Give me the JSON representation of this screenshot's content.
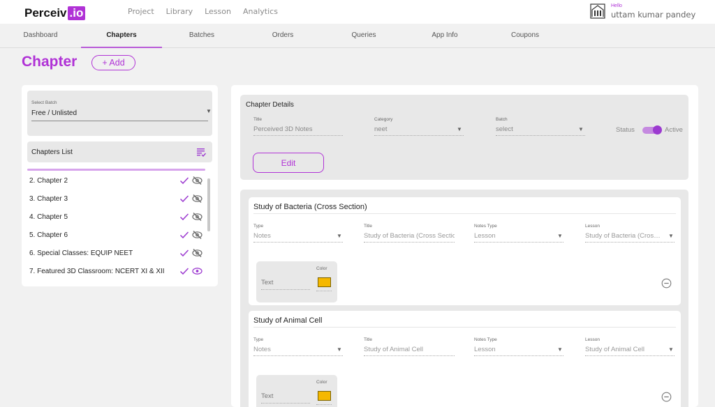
{
  "app": {
    "logo_main": "Perceiv",
    "logo_accent": ".io",
    "brand_color": "#b032d6"
  },
  "topnav": [
    "Project",
    "Library",
    "Lesson",
    "Analytics"
  ],
  "user": {
    "greeting": "Hello",
    "name": "uttam kumar pandey",
    "avatar_icon": "avatar-icon"
  },
  "tabs": [
    {
      "label": "Dashboard",
      "active": false
    },
    {
      "label": "Chapters",
      "active": true
    },
    {
      "label": "Batches",
      "active": false
    },
    {
      "label": "Orders",
      "active": false
    },
    {
      "label": "Queries",
      "active": false
    },
    {
      "label": "App Info",
      "active": false
    },
    {
      "label": "Coupons",
      "active": false
    }
  ],
  "page": {
    "title": "Chapter",
    "add_label": "+ Add"
  },
  "batch": {
    "label": "Select Batch",
    "value": "Free / Unlisted"
  },
  "chapters_list": {
    "title": "Chapters List",
    "items": [
      {
        "name": "2. Chapter 2",
        "visible": false
      },
      {
        "name": "3. Chapter 3",
        "visible": false
      },
      {
        "name": "4. Chapter 5",
        "visible": false
      },
      {
        "name": "5. Chapter 6",
        "visible": false
      },
      {
        "name": "6. Special Classes: EQUIP NEET",
        "visible": false
      },
      {
        "name": "7. Featured 3D Classroom: NCERT XI & XII",
        "visible": true
      }
    ]
  },
  "details": {
    "heading": "Chapter Details",
    "title_label": "Title",
    "title_value": "Perceived 3D Notes",
    "category_label": "Category",
    "category_value": "neet",
    "batch_label": "Batch",
    "batch_value": "select",
    "status_label": "Status",
    "status_value": "Active",
    "edit_label": "Edit"
  },
  "lessons": [
    {
      "heading": "Study of Bacteria (Cross Section)",
      "type_label": "Type",
      "type_value": "Notes",
      "title_label": "Title",
      "title_value": "Study of Bacteria (Cross Section)",
      "notes_type_label": "Notes Type",
      "notes_type_value": "Lesson",
      "lesson_label": "Lesson",
      "lesson_value": "Study of Bacteria (Cross...",
      "text_label": "Text",
      "color_label": "Color",
      "color_value": "#f5b800"
    },
    {
      "heading": "Study of Animal Cell",
      "type_label": "Type",
      "type_value": "Notes",
      "title_label": "Title",
      "title_value": "Study of Animal Cell",
      "notes_type_label": "Notes Type",
      "notes_type_value": "Lesson",
      "lesson_label": "Lesson",
      "lesson_value": "Study of Animal Cell",
      "text_label": "Text",
      "color_label": "Color",
      "color_value": "#f5b800"
    }
  ]
}
